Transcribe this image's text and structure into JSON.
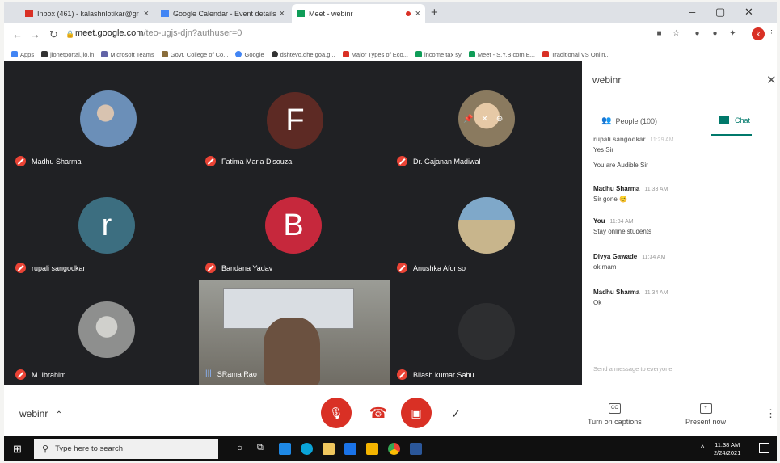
{
  "browser": {
    "tabs": [
      {
        "label": "Inbox (461) - kalashnlotikar@gr",
        "favicon_color": "#d93025"
      },
      {
        "label": "Google Calendar - Event details",
        "favicon_color": "#4285f4"
      },
      {
        "label": "Meet - webinr",
        "favicon_color": "#0f9d58"
      }
    ],
    "new_tab": "+",
    "url_host": "meet.google.com",
    "url_path": "/teo-ugjs-djn?authuser=0",
    "bookmarks": [
      {
        "label": "Apps",
        "color": "#4285f4"
      },
      {
        "label": "jionetportal.jio.in",
        "color": "#333333"
      },
      {
        "label": "Microsoft Teams",
        "color": "#6264a7"
      },
      {
        "label": "Govt. College of Co...",
        "color": "#8a6d3b"
      },
      {
        "label": "Google",
        "color": "#4285f4"
      },
      {
        "label": "dshtevo.dhe.goa.g...",
        "color": "#333333"
      },
      {
        "label": "Major Types of Eco...",
        "color": "#d93025"
      },
      {
        "label": "income tax sy",
        "color": "#0f9d58"
      },
      {
        "label": "Meet - S.Y.B.com E...",
        "color": "#0f9d58"
      },
      {
        "label": "Traditional VS Onlin...",
        "color": "#d93025"
      }
    ],
    "profile_initial": "k"
  },
  "participants": [
    {
      "name": "Madhu Sharma",
      "type": "photo",
      "photo_color": "#6b8fb8"
    },
    {
      "name": "Fatima Maria D'souza",
      "type": "initial",
      "initial": "F",
      "avatar_color": "#5d2a24"
    },
    {
      "name": "Dr. Gajanan Madiwal",
      "type": "photo",
      "photo_color": "#b49a72"
    },
    {
      "name": "rupali sangodkar",
      "type": "initial",
      "initial": "r",
      "avatar_color": "#3c6e80"
    },
    {
      "name": "Bandana Yadav",
      "type": "initial",
      "initial": "B",
      "avatar_color": "#c6283c"
    },
    {
      "name": "Anushka Afonso",
      "type": "photo",
      "photo_color": "#c8b58c"
    },
    {
      "name": "M. Ibrahim",
      "type": "photo",
      "photo_color": "#9fa0a0"
    },
    {
      "name": "SRama Rao",
      "type": "video",
      "photo_color": "#8c8d86"
    },
    {
      "name": "Bilash kumar Sahu",
      "type": "initial",
      "initial": "",
      "avatar_color": "#2d2e30"
    }
  ],
  "chat_panel": {
    "title": "webinr",
    "people_tab": "People (100)",
    "chat_tab": "Chat",
    "messages": [
      {
        "sender": "rupali sangodkar",
        "time": "11:29 AM",
        "text": "Yes Sir"
      },
      {
        "sender": "",
        "time": "",
        "text": "You are Audible Sir"
      },
      {
        "sender": "Madhu Sharma",
        "time": "11:33 AM",
        "text": "Sir gone 😊"
      },
      {
        "sender": "You",
        "time": "11:34 AM",
        "text": "Stay online students"
      },
      {
        "sender": "Divya Gawade",
        "time": "11:34 AM",
        "text": "ok mam"
      },
      {
        "sender": "Madhu Sharma",
        "time": "11:34 AM",
        "text": "Ok"
      }
    ],
    "input_placeholder": "Send a message to everyone"
  },
  "bottom_bar": {
    "meeting_name": "webinr",
    "captions_label": "Turn on captions",
    "present_label": "Present now"
  },
  "taskbar": {
    "search_placeholder": "Type here to search",
    "time": "11:38 AM",
    "date": "2/24/2021"
  }
}
